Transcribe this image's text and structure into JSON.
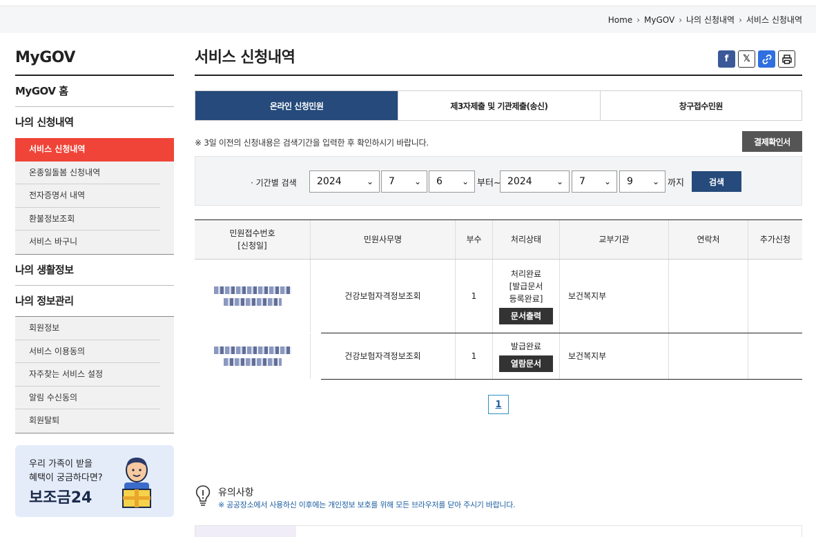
{
  "breadcrumb": [
    "Home",
    "MyGOV",
    "나의 신청내역",
    "서비스 신청내역"
  ],
  "sidebar": {
    "title": "MyGOV",
    "home": "MyGOV 홈",
    "sections": [
      {
        "title": "나의 신청내역",
        "items": [
          "서비스 신청내역",
          "온종일돌봄 신청내역",
          "전자증명서 내역",
          "환불정보조회",
          "서비스 바구니"
        ]
      },
      {
        "title": "나의 생활정보",
        "items": []
      },
      {
        "title": "나의 정보관리",
        "items": [
          "회원정보",
          "서비스 이용동의",
          "자주찾는 서비스 설정",
          "알림 수신동의",
          "회원탈퇴"
        ]
      }
    ],
    "active_item": "서비스 신청내역"
  },
  "banner": {
    "line1": "우리 가족이 받을",
    "line2": "혜택이 궁금하다면?",
    "brand": "보조금24"
  },
  "page": {
    "title": "서비스 신청내역"
  },
  "share_icons": [
    "facebook-icon",
    "x-icon",
    "link-icon",
    "print-icon"
  ],
  "tabs": [
    "온라인 신청민원",
    "제3자제출 및 기관제출(송신)",
    "창구접수민원"
  ],
  "active_tab": 0,
  "notice": "※ 3일 이전의 신청내용은 검색기간을 입력한 후 확인하시기 바랍니다.",
  "receipt_button": "결제확인서",
  "search": {
    "label": "· 기간별 검색",
    "from": {
      "year": "2024",
      "month": "7",
      "day": "6"
    },
    "from_suffix": "부터~",
    "to": {
      "year": "2024",
      "month": "7",
      "day": "9"
    },
    "to_suffix": "까지",
    "button": "검색"
  },
  "table": {
    "headers": [
      "민원접수번호\n[신청일]",
      "민원사무명",
      "부수",
      "처리상태",
      "교부기관",
      "연락처",
      "추가신청"
    ],
    "rows": [
      {
        "name": "건강보험자격정보조회",
        "copies": "1",
        "status": [
          "처리완료",
          "[발급문서",
          "등록완료]"
        ],
        "status_button": "문서출력",
        "agency": "보건복지부",
        "contact": "",
        "extra": ""
      },
      {
        "name": "건강보험자격정보조회",
        "copies": "1",
        "status": [
          "발급완료"
        ],
        "status_button": "열람문서",
        "agency": "보건복지부",
        "contact": "",
        "extra": ""
      }
    ]
  },
  "pagination": {
    "current": "1"
  },
  "caution": {
    "title": "유의사항",
    "desc": "※ 공공장소에서 사용하신 이후에는 개인정보 보호를 위해 모든 브라우저를 닫아 주시기 바랍니다."
  },
  "colors": {
    "primary": "#254a7b",
    "active_menu": "#f04438"
  }
}
